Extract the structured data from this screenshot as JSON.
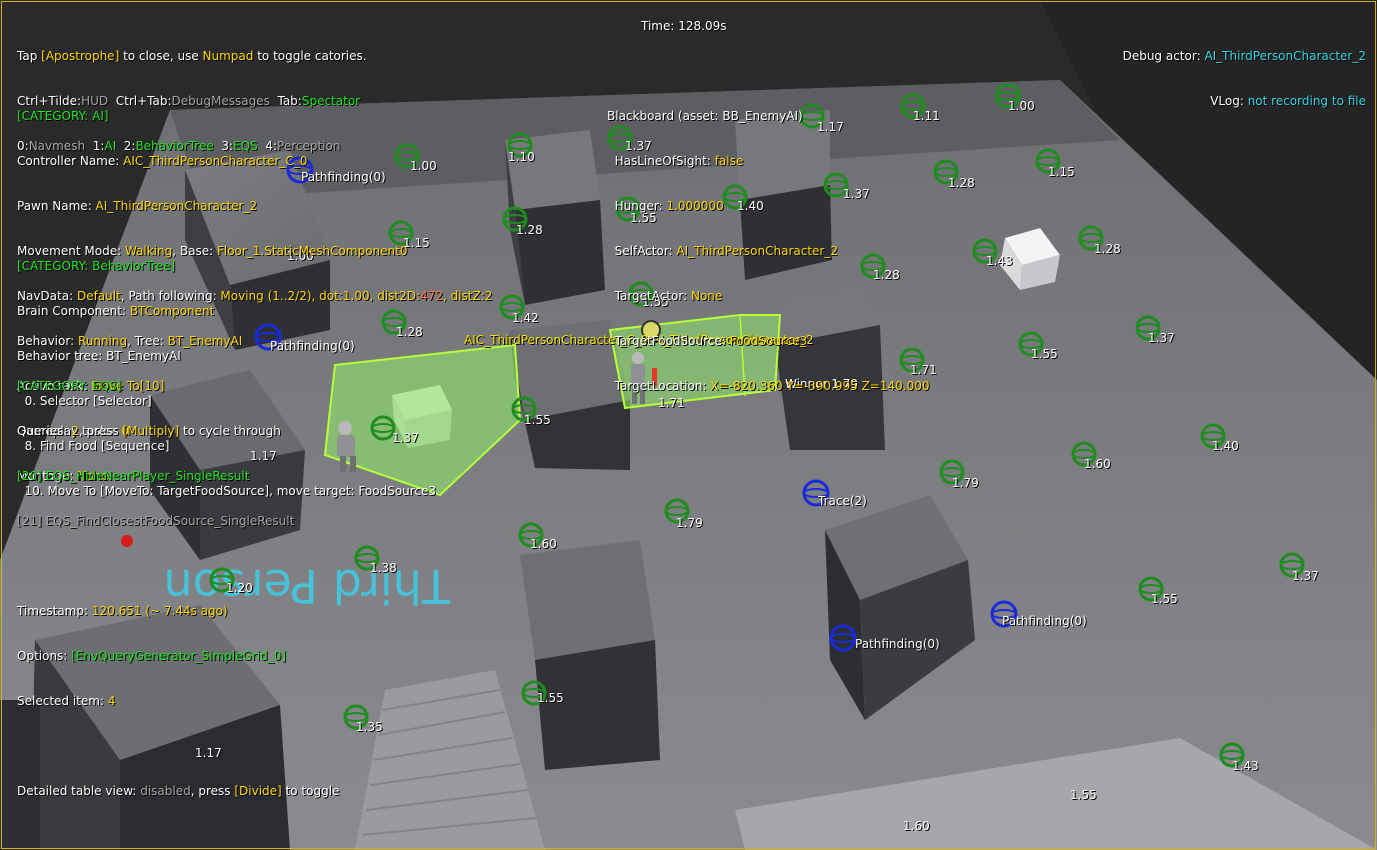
{
  "hud_left": {
    "line1": {
      "a": "Tap ",
      "b": "[Apostrophe]",
      "c": " to close, use ",
      "d": "Numpad",
      "e": " to toggle catories."
    },
    "line2": {
      "a": "Ctrl+Tilde:",
      "b": "HUD",
      "c": "  Ctrl+Tab:",
      "d": "DebugMessages",
      "e": "  Tab:",
      "f": "Spectator"
    },
    "line3": {
      "a": "0:",
      "b": "Navmesh",
      "c": "  1:",
      "d": "AI",
      "e": "  2:",
      "f": "BehaviorTree",
      "g": "  3:",
      "h": "EQS",
      "i": "  4:",
      "j": "Perception"
    }
  },
  "time": {
    "label": "Time: ",
    "value": "128.09s"
  },
  "debug_actor": {
    "label": "Debug actor: ",
    "value": "AI_ThirdPersonCharacter_2",
    "vlog_label": "VLog: ",
    "vlog_value": "not recording to file"
  },
  "category_ai": {
    "header": "[CATEGORY: AI]",
    "controller_label": "Controller Name: ",
    "controller_value": "AIC_ThirdPersonCharacter_C_0",
    "pawn_label": "Pawn Name: ",
    "pawn_value": "AI_ThirdPersonCharacter_2",
    "movement_label": "Movement Mode: ",
    "movement_value": "Walking",
    "base_label": ", Base: ",
    "base_value": "Floor_1.StaticMeshComponent0",
    "navdata_label": "NavData: ",
    "navdata_value": "Default",
    "path_label": ", Path following: ",
    "path_value": "Moving (1..2/2), dot:1.00, dist2D:",
    "dist2d_value": "472",
    "distz_label": ", distZ:",
    "distz_value": "2",
    "behavior_label": "Behavior: ",
    "behavior_value": "Running",
    "tree_label": ", Tree: ",
    "tree_value": "BT_EnemyAI",
    "task_label": "Active task: ",
    "task_value": "Move To[10]",
    "gameplay_label": "Gameplay tasks: ",
    "gameplay_value": "0",
    "montage_label": "Montage: ",
    "montage_value": "None"
  },
  "category_bt": {
    "header": "[CATEGORY: BehaviorTree]",
    "brain_label": "Brain Component: ",
    "brain_value": "BTComponent",
    "tree_line": "Behavior tree: BT_EnemyAI",
    "nodes": [
      "  0. Selector [Selector]",
      "  8. Find Food [Sequence]",
      "  10. Move To [MoveTo: TargetFoodSource], move target: FoodSource3"
    ]
  },
  "category_eqs": {
    "header": "[CATEGORY: EQS]",
    "queries_label": "Queries: ",
    "queries_value": "2",
    "queries_mid": ", press ",
    "queries_key": "[Multiply]",
    "queries_end": " to cycle through",
    "query_active": "[20] EQS_HideNearPlayer_SingleResult",
    "query_other": "[21] EQS_FindClosestFoodSource_SingleResult",
    "timestamp_label": "Timestamp: ",
    "timestamp_value": "120.651 (~ 7.44s ago)",
    "options_label": "Options: ",
    "options_value": "[EnvQueryGenerator_SimpleGrid_0]",
    "selected_label": "Selected item: ",
    "selected_value": "4",
    "table_label": "Detailed table view: ",
    "table_value": "disabled",
    "table_mid": ", press ",
    "table_key": "[Divide]",
    "table_end": " to toggle"
  },
  "blackboard": {
    "header": "Blackboard (asset: BB_EnemyAI)",
    "entries": [
      {
        "key": "  HasLineOfSight: ",
        "value": "false"
      },
      {
        "key": "  Hunger: ",
        "value": "1.000000"
      },
      {
        "key": "  SelfActor: ",
        "value": "AI_ThirdPersonCharacter_2"
      },
      {
        "key": "  TargetActor: ",
        "value": "None"
      },
      {
        "key": "  TargetFoodSource: ",
        "value": "FoodSource3"
      },
      {
        "key": "  TargetLocation: ",
        "value": "X=-820.360 Y=-390.995 Z=140.000"
      }
    ]
  },
  "world_labels": {
    "pathfinding": "Pathfinding(0)",
    "trace": "Trace(2)",
    "winner": "Winner 1.79",
    "actor_tag": "AIC_ThirdPersonCharacter_C_0 AI_ThirdPersonCharacter_2",
    "floor_text": "Third Person",
    "scores": [
      "1.00",
      "1.10",
      "1.17",
      "1.11",
      "1.00",
      "1.37",
      "1.15",
      "1.28",
      "1.40",
      "1.37",
      "1.28",
      "1.15",
      "1.00",
      "1.28",
      "1.55",
      "1.43",
      "1.28",
      "1.42",
      "1.55",
      "1.28",
      "1.37",
      "1.55",
      "1.71",
      "1.37",
      "1.55",
      "1.71",
      "1.17",
      "1.37",
      "1.40",
      "1.60",
      "1.79",
      "1.79",
      "1.60",
      "1.38",
      "1.20",
      "1.37",
      "1.55",
      "1.55",
      "1.35",
      "1.17",
      "1.43",
      "1.55",
      "1.60"
    ]
  },
  "colors": {
    "accent_yellow": "#ffd700",
    "accent_green": "#22e322",
    "accent_cyan": "#33d6e6",
    "eqs_item": "#1e8c1e",
    "query_blue": "#1a2ad8",
    "frame": "#d4b400"
  }
}
